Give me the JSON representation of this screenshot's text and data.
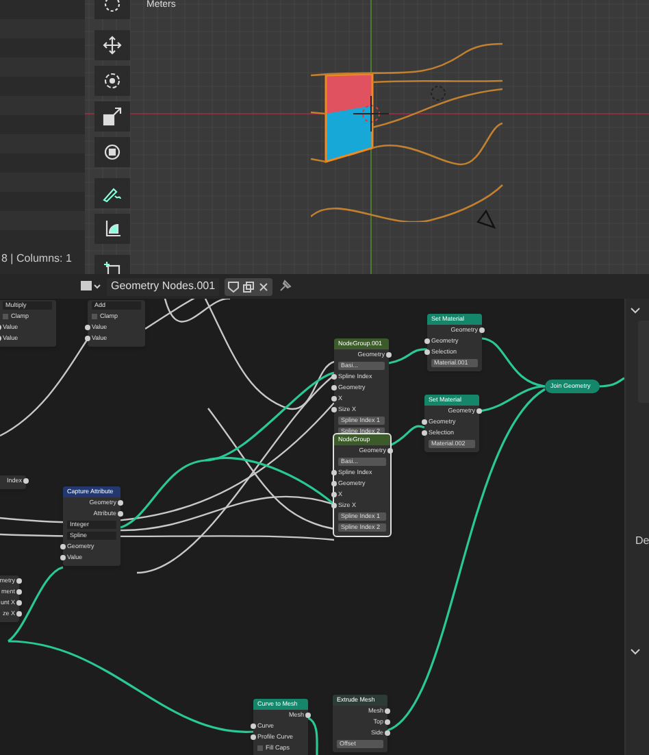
{
  "viewport": {
    "units_label": "Meters"
  },
  "spreadsheet": {
    "footer": "8 | Columns: 1"
  },
  "node_header": {
    "tree_name": "Geometry Nodes.001"
  },
  "nodes": [
    {
      "kind": "converter",
      "selected": false,
      "rows": [
        {
          "kind": "dropdown",
          "label": "Multiply"
        },
        {
          "kind": "check",
          "label": "Clamp"
        },
        {
          "kind": "in",
          "label": "Value"
        },
        {
          "kind": "in",
          "label": "Value"
        }
      ]
    },
    {
      "kind": "converter",
      "selected": false,
      "rows": [
        {
          "kind": "dropdown",
          "label": "Add"
        },
        {
          "kind": "check",
          "label": "Clamp"
        },
        {
          "kind": "in",
          "label": "Value"
        },
        {
          "kind": "in",
          "label": "Value"
        }
      ]
    },
    {
      "kind": "group",
      "title": "NodeGroup.001",
      "selected": false,
      "rows": [
        {
          "kind": "out",
          "label": "Geometry"
        },
        {
          "kind": "field",
          "label": "Basi..."
        },
        {
          "kind": "in",
          "label": "Spline Index"
        },
        {
          "kind": "in",
          "label": "Geometry"
        },
        {
          "kind": "in",
          "label": "X"
        },
        {
          "kind": "in",
          "label": "Size X"
        },
        {
          "kind": "field",
          "label": "Spline Index 1"
        },
        {
          "kind": "field",
          "label": "Spline Index 2"
        }
      ]
    },
    {
      "kind": "geometry",
      "title": "Set Material",
      "selected": false,
      "rows": [
        {
          "kind": "out",
          "label": "Geometry"
        },
        {
          "kind": "in",
          "label": "Geometry"
        },
        {
          "kind": "in",
          "label": "Selection"
        },
        {
          "kind": "field",
          "label": "Material.001"
        }
      ]
    },
    {
      "kind": "geometry",
      "title": "Set Material",
      "selected": false,
      "rows": [
        {
          "kind": "out",
          "label": "Geometry"
        },
        {
          "kind": "in",
          "label": "Geometry"
        },
        {
          "kind": "in",
          "label": "Selection"
        },
        {
          "kind": "field",
          "label": "Material.002"
        }
      ]
    },
    {
      "kind": "group",
      "title": "NodeGroup",
      "selected": true,
      "rows": [
        {
          "kind": "out",
          "label": "Geometry"
        },
        {
          "kind": "field",
          "label": "Basi..."
        },
        {
          "kind": "in",
          "label": "Spline Index"
        },
        {
          "kind": "in",
          "label": "Geometry"
        },
        {
          "kind": "in",
          "label": "X"
        },
        {
          "kind": "in",
          "label": "Size X"
        },
        {
          "kind": "field",
          "label": "Spline Index 1"
        },
        {
          "kind": "field",
          "label": "Spline Index 2"
        }
      ]
    },
    {
      "kind": "join",
      "title": "Join Geometry",
      "selected": false
    },
    {
      "kind": "input",
      "selected": false,
      "rows": [
        {
          "kind": "out",
          "label": "Index"
        }
      ]
    },
    {
      "kind": "attribute",
      "title": "Capture Attribute",
      "selected": false,
      "rows": [
        {
          "kind": "out",
          "label": "Geometry"
        },
        {
          "kind": "out",
          "label": "Attribute"
        },
        {
          "kind": "dropdown",
          "label": "Integer"
        },
        {
          "kind": "dropdown",
          "label": "Spline"
        },
        {
          "kind": "in",
          "label": "Geometry"
        },
        {
          "kind": "in",
          "label": "Value"
        }
      ]
    },
    {
      "kind": "group",
      "selected": false,
      "rows": [
        {
          "kind": "out",
          "label": "metry"
        },
        {
          "kind": "out",
          "label": "ment"
        },
        {
          "kind": "out",
          "label": "unt X"
        },
        {
          "kind": "out",
          "label": "ze X"
        }
      ]
    },
    {
      "kind": "geometry",
      "title": "Curve to Mesh",
      "selected": false,
      "rows": [
        {
          "kind": "out",
          "label": "Mesh"
        },
        {
          "kind": "in",
          "label": "Curve"
        },
        {
          "kind": "in",
          "label": "Profile Curve"
        },
        {
          "kind": "check",
          "label": "Fill Caps"
        }
      ]
    },
    {
      "kind": "mesh",
      "title": "Extrude Mesh",
      "selected": false,
      "rows": [
        {
          "kind": "out",
          "label": "Mesh"
        },
        {
          "kind": "out",
          "label": "Top"
        },
        {
          "kind": "out",
          "label": "Side"
        },
        {
          "kind": "field",
          "label": "Offset"
        }
      ]
    }
  ],
  "sidebar": {
    "label": "De"
  }
}
